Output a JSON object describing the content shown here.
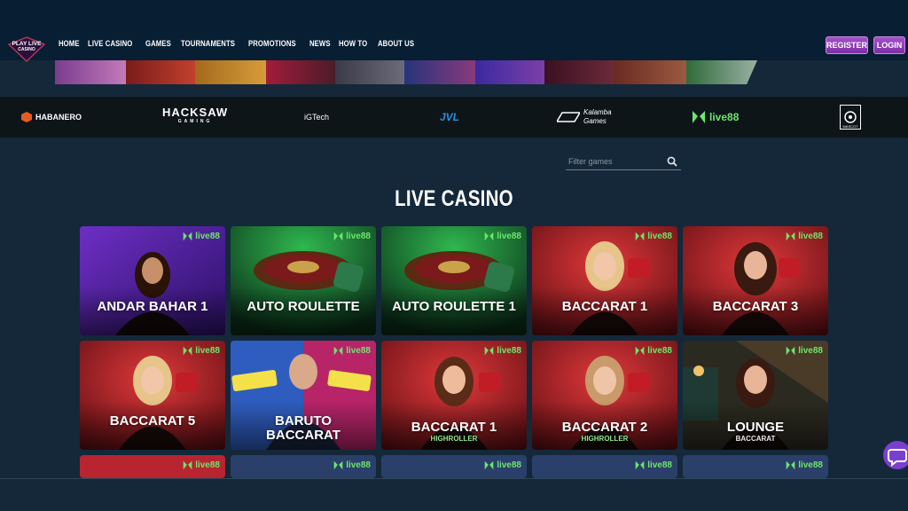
{
  "brand": {
    "logo_text_line1": "PLAY LIVE",
    "logo_text_line2": "CASINO"
  },
  "nav": [
    "HOME",
    "LIVE CASINO",
    "GAMES",
    "TOURNAMENTS",
    "PROMOTIONS",
    "NEWS",
    "HOW TO",
    "ABOUT US"
  ],
  "auth": {
    "register": "REGISTER",
    "login": "LOGIN"
  },
  "providers": {
    "habanero": "HABANERO",
    "hacksaw": "HACKSAW",
    "hacksaw_sub": "GAMING",
    "igtech": "iGTech",
    "jvl": "JVL",
    "kalamba_line1": "Kalamba",
    "kalamba_line2": "Games",
    "live88": "live88",
    "mascot": "MASCOT"
  },
  "filter": {
    "placeholder": "Filter games"
  },
  "section_title": "LIVE CASINO",
  "badge_label": "live88",
  "games": [
    {
      "name": "ANDAR BAHAR 1",
      "sub": ""
    },
    {
      "name": "AUTO ROULETTE",
      "sub": ""
    },
    {
      "name": "AUTO ROULETTE 1",
      "sub": ""
    },
    {
      "name": "BACCARAT 1",
      "sub": ""
    },
    {
      "name": "BACCARAT 3",
      "sub": ""
    },
    {
      "name": "BACCARAT 5",
      "sub": ""
    },
    {
      "name_line1": "BARUTO",
      "name_line2": "BACCARAT",
      "sub": ""
    },
    {
      "name": "BACCARAT 1",
      "sub": "HIGHROLLER"
    },
    {
      "name": "BACCARAT 2",
      "sub": "HIGHROLLER"
    },
    {
      "name": "LOUNGE",
      "sub": "BACCARAT"
    }
  ],
  "colors": {
    "accent_purple": "#8a3bbd",
    "badge_green": "#6ee56c",
    "header_bg": "#071e33",
    "page_bg": "#14283a"
  }
}
